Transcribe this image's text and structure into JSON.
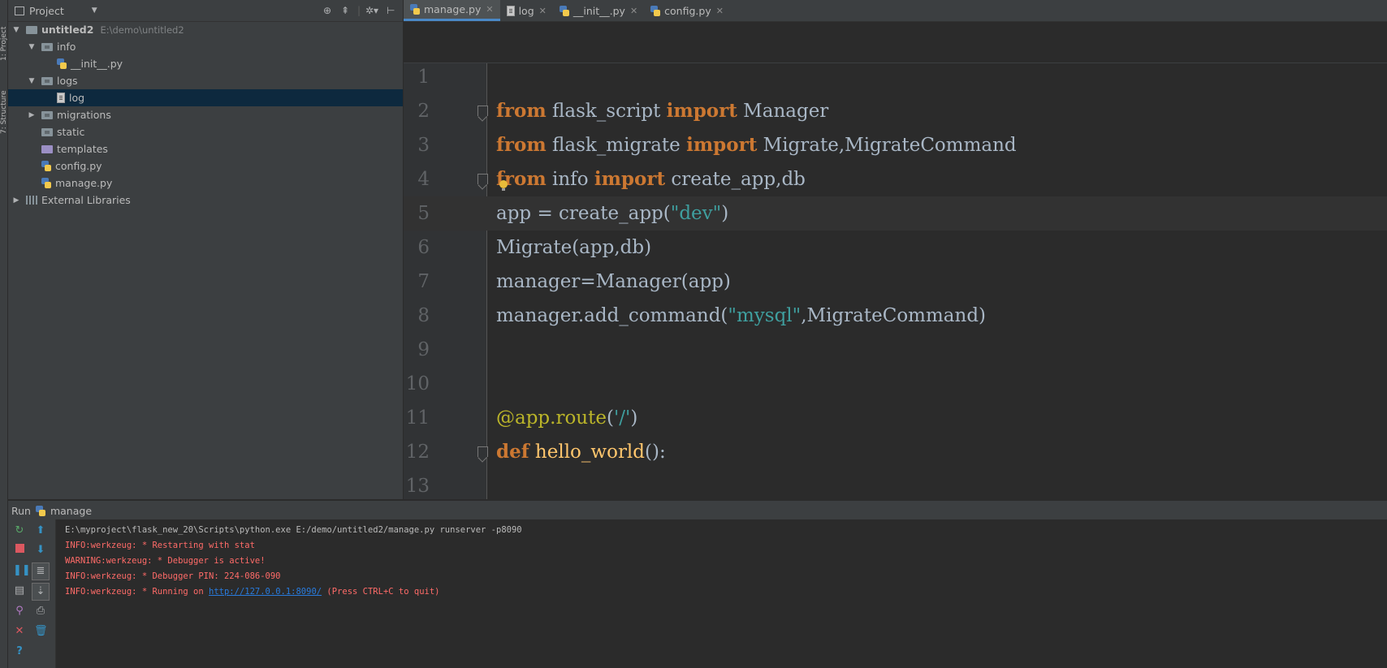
{
  "left_strip": {
    "tabs": [
      "1: Project",
      "7: Structure"
    ]
  },
  "project": {
    "header_label": "Project",
    "header_icons": [
      "target-icon",
      "collapse-icon",
      "gear-icon",
      "hide-icon"
    ],
    "tree": [
      {
        "name": "untitled2",
        "path": "E:\\demo\\untitled2",
        "type": "folder",
        "arrow": "down",
        "depth": 0,
        "bold": true
      },
      {
        "name": "info",
        "type": "package",
        "arrow": "down",
        "depth": 1
      },
      {
        "name": "__init__.py",
        "type": "py",
        "depth": 2
      },
      {
        "name": "logs",
        "type": "package",
        "arrow": "down",
        "depth": 1
      },
      {
        "name": "log",
        "type": "file",
        "depth": 2,
        "selected": true
      },
      {
        "name": "migrations",
        "type": "package",
        "arrow": "right",
        "depth": 1
      },
      {
        "name": "static",
        "type": "package",
        "depth": 1
      },
      {
        "name": "templates",
        "type": "templates",
        "depth": 1
      },
      {
        "name": "config.py",
        "type": "py",
        "depth": 1
      },
      {
        "name": "manage.py",
        "type": "py",
        "depth": 1
      },
      {
        "name": "External Libraries",
        "type": "library",
        "arrow": "right",
        "depth": 0
      }
    ]
  },
  "tabs": [
    {
      "label": "manage.py",
      "icon": "py",
      "active": true
    },
    {
      "label": "log",
      "icon": "file",
      "active": false
    },
    {
      "label": "__init__.py",
      "icon": "py",
      "active": false
    },
    {
      "label": "config.py",
      "icon": "py",
      "active": false
    }
  ],
  "editor": {
    "current_line": 5,
    "lines": [
      {
        "n": "1",
        "tokens": []
      },
      {
        "n": "2",
        "fold": true,
        "tokens": [
          [
            "kw",
            "from"
          ],
          [
            "t",
            " flask_script "
          ],
          [
            "kw",
            "import"
          ],
          [
            "t",
            " Manager"
          ]
        ]
      },
      {
        "n": "3",
        "tokens": [
          [
            "kw",
            "from"
          ],
          [
            "t",
            " flask_migrate "
          ],
          [
            "kw",
            "import"
          ],
          [
            "t",
            " Migrate,MigrateCommand"
          ]
        ]
      },
      {
        "n": "4",
        "fold": true,
        "bulb": true,
        "tokens": [
          [
            "kw",
            "from"
          ],
          [
            "t",
            " info "
          ],
          [
            "kw",
            "import"
          ],
          [
            "t",
            " create_app,db"
          ]
        ]
      },
      {
        "n": "5",
        "tokens": [
          [
            "t",
            "app = create_app("
          ],
          [
            "str",
            "\"dev\""
          ],
          [
            "t",
            ")"
          ]
        ]
      },
      {
        "n": "6",
        "tokens": [
          [
            "t",
            "Migrate(app,db)"
          ]
        ]
      },
      {
        "n": "7",
        "tokens": [
          [
            "t",
            "manager=Manager(app)"
          ]
        ]
      },
      {
        "n": "8",
        "tokens": [
          [
            "t",
            "manager.add_command("
          ],
          [
            "str",
            "\"mysql\""
          ],
          [
            "t",
            ",MigrateCommand)"
          ]
        ]
      },
      {
        "n": "9",
        "tokens": []
      },
      {
        "n": "10",
        "tokens": []
      },
      {
        "n": "11",
        "tokens": [
          [
            "dec",
            "@app.route"
          ],
          [
            "t",
            "("
          ],
          [
            "str",
            "'/'"
          ],
          [
            "t",
            ")"
          ]
        ]
      },
      {
        "n": "12",
        "fold": true,
        "tokens": [
          [
            "kw",
            "def"
          ],
          [
            "fn",
            " hello_world"
          ],
          [
            "t",
            "():"
          ]
        ]
      },
      {
        "n": "13",
        "tokens": []
      }
    ]
  },
  "run": {
    "label": "Run",
    "config_name": "manage",
    "toolbar_icons": [
      "rerun-icon",
      "up-icon",
      "stop-icon",
      "down-icon",
      "pause-icon",
      "soft-wrap-icon",
      "dump-threads-icon",
      "scroll-to-end-icon",
      "pin-icon",
      "print-icon",
      "close-icon",
      "trash-icon",
      "help-icon"
    ],
    "console": [
      {
        "kind": "cmd",
        "text": "E:\\myproject\\flask_new_20\\Scripts\\python.exe E:/demo/untitled2/manage.py runserver -p8090"
      },
      {
        "kind": "err",
        "text": "INFO:werkzeug: * Restarting with stat"
      },
      {
        "kind": "err",
        "text": "WARNING:werkzeug: * Debugger is active!"
      },
      {
        "kind": "err",
        "text": "INFO:werkzeug: * Debugger PIN: 224-086-090"
      },
      {
        "kind": "err",
        "text": "INFO:werkzeug: * Running on ",
        "link": "http://127.0.0.1:8090/",
        "suffix": " (Press CTRL+C to quit)"
      }
    ]
  }
}
